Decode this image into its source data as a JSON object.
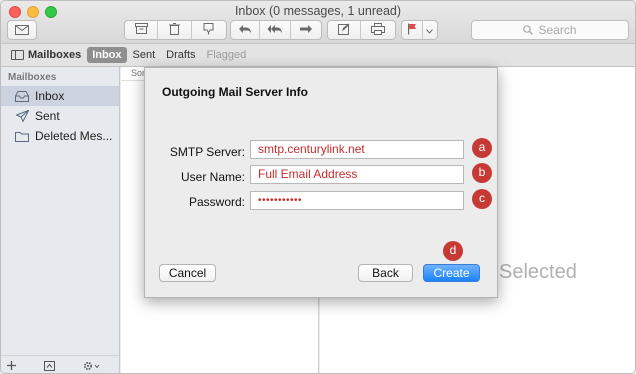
{
  "window": {
    "title": "Inbox (0 messages, 1 unread)"
  },
  "toolbar": {
    "icons": [
      "compose-icon",
      "archive-icon",
      "trash-icon",
      "junk-icon",
      "reply-icon",
      "reply-all-icon",
      "forward-icon",
      "new-note-icon",
      "print-icon",
      "flag-icon",
      "chevron-down-icon"
    ],
    "search_placeholder": "Search"
  },
  "favorites": {
    "mailboxes": "Mailboxes",
    "inbox": "Inbox",
    "sent": "Sent",
    "drafts": "Drafts",
    "flagged": "Flagged"
  },
  "sidebar": {
    "heading": "Mailboxes",
    "items": [
      {
        "label": "Inbox",
        "icon": "inbox-icon"
      },
      {
        "label": "Sent",
        "icon": "paper-plane-icon"
      },
      {
        "label": "Deleted Mes...",
        "icon": "folder-icon"
      }
    ]
  },
  "list": {
    "sort_label": "Sor"
  },
  "viewer": {
    "empty_text": "Selected"
  },
  "dialog": {
    "title": "Outgoing Mail Server Info",
    "smtp_label": "SMTP Server:",
    "smtp_value": "smtp.centurylink.net",
    "username_label": "User Name:",
    "username_value": "Full Email Address",
    "password_label": "Password:",
    "password_value": "•••••••••••",
    "cancel": "Cancel",
    "back": "Back",
    "create": "Create"
  },
  "badges": {
    "a": "a",
    "b": "b",
    "c": "c",
    "d": "d"
  },
  "colors": {
    "badge": "#c63a36",
    "field_text": "#c62d2d",
    "primary_button": "#1a82fb"
  }
}
